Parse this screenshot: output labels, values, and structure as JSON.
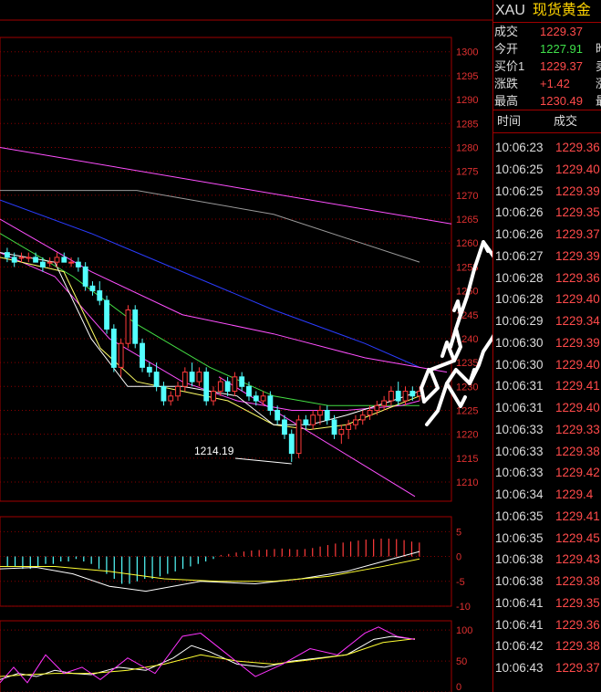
{
  "chart_data": [
    {
      "type": "candlestick",
      "ylim": [
        1206,
        1303
      ],
      "yticks": [
        1300,
        1295,
        1290,
        1285,
        1280,
        1275,
        1270,
        1265,
        1260,
        1255,
        1250,
        1245,
        1240,
        1235,
        1230,
        1225,
        1220,
        1215,
        1210
      ],
      "annotations": [
        "1214.19"
      ],
      "candles": [
        [
          1258,
          1259,
          1256,
          1257
        ],
        [
          1257,
          1258,
          1255,
          1256
        ],
        [
          1257,
          1258,
          1256,
          1257
        ],
        [
          1257,
          1258,
          1256,
          1257
        ],
        [
          1257,
          1258,
          1256,
          1256
        ],
        [
          1256,
          1257,
          1254,
          1255
        ],
        [
          1256,
          1257,
          1255,
          1256
        ],
        [
          1256,
          1258,
          1255,
          1257
        ],
        [
          1257,
          1258,
          1256,
          1256
        ],
        [
          1256,
          1257,
          1255,
          1256
        ],
        [
          1256,
          1257,
          1254,
          1255
        ],
        [
          1255,
          1256,
          1250,
          1251
        ],
        [
          1251,
          1252,
          1249,
          1250
        ],
        [
          1250,
          1252,
          1247,
          1248
        ],
        [
          1248,
          1249,
          1241,
          1242
        ],
        [
          1242,
          1243,
          1233,
          1234
        ],
        [
          1234,
          1240,
          1232,
          1239
        ],
        [
          1239,
          1247,
          1238,
          1246
        ],
        [
          1246,
          1247,
          1238,
          1239
        ],
        [
          1239,
          1240,
          1233,
          1234
        ],
        [
          1234,
          1235,
          1232,
          1233
        ],
        [
          1233,
          1235,
          1229,
          1230
        ],
        [
          1230,
          1231,
          1226,
          1227
        ],
        [
          1227,
          1229,
          1226,
          1228
        ],
        [
          1228,
          1231,
          1227,
          1230
        ],
        [
          1230,
          1234,
          1229,
          1233
        ],
        [
          1233,
          1235,
          1230,
          1231
        ],
        [
          1231,
          1234,
          1230,
          1233
        ],
        [
          1233,
          1234,
          1226,
          1227
        ],
        [
          1227,
          1230,
          1226,
          1229
        ],
        [
          1229,
          1232,
          1228,
          1231
        ],
        [
          1231,
          1232,
          1228,
          1229
        ],
        [
          1229,
          1233,
          1228,
          1232
        ],
        [
          1232,
          1233,
          1229,
          1230
        ],
        [
          1230,
          1231,
          1227,
          1228
        ],
        [
          1228,
          1229,
          1226,
          1227
        ],
        [
          1227,
          1229,
          1226,
          1228
        ],
        [
          1228,
          1229,
          1224,
          1225
        ],
        [
          1225,
          1226,
          1222,
          1223
        ],
        [
          1223,
          1224,
          1219,
          1220
        ],
        [
          1220,
          1221,
          1214.2,
          1216
        ],
        [
          1216,
          1224,
          1215,
          1223
        ],
        [
          1223,
          1224,
          1221,
          1222
        ],
        [
          1222,
          1225,
          1221,
          1224
        ],
        [
          1224,
          1226,
          1222,
          1225
        ],
        [
          1225,
          1226,
          1222,
          1223
        ],
        [
          1223,
          1224,
          1219,
          1220
        ],
        [
          1220,
          1222,
          1218,
          1221
        ],
        [
          1221,
          1223,
          1219,
          1222
        ],
        [
          1222,
          1224,
          1221,
          1223
        ],
        [
          1223,
          1225,
          1222,
          1224
        ],
        [
          1224,
          1226,
          1223,
          1225
        ],
        [
          1225,
          1227,
          1224,
          1226
        ],
        [
          1226,
          1228,
          1225,
          1227
        ],
        [
          1227,
          1230,
          1226,
          1229
        ],
        [
          1229,
          1231,
          1226,
          1227
        ],
        [
          1227,
          1230,
          1226,
          1229
        ],
        [
          1229,
          1230,
          1227,
          1228
        ],
        [
          1228,
          1230,
          1227,
          1229
        ]
      ],
      "ma_lines": [
        {
          "color": "#ff4fff",
          "points": [
            [
              0,
              1280
            ],
            [
              495,
              1264
            ]
          ]
        },
        {
          "color": "#9a9a9a",
          "points": [
            [
              0,
              1271
            ],
            [
              150,
              1271
            ],
            [
              300,
              1266
            ],
            [
              460,
              1256
            ]
          ]
        },
        {
          "color": "#2a3cff",
          "points": [
            [
              0,
              1269
            ],
            [
              100,
              1262
            ],
            [
              200,
              1254
            ],
            [
              300,
              1246
            ],
            [
              400,
              1239
            ],
            [
              460,
              1234
            ]
          ]
        },
        {
          "color": "#ff4fff",
          "points": [
            [
              0,
              1265
            ],
            [
              100,
              1254
            ],
            [
              200,
              1245
            ],
            [
              300,
              1241
            ],
            [
              400,
              1236
            ],
            [
              490,
              1233
            ]
          ]
        },
        {
          "color": "#44dd44",
          "points": [
            [
              0,
              1262
            ],
            [
              80,
              1253
            ],
            [
              150,
              1243
            ],
            [
              230,
              1234
            ],
            [
              300,
              1228
            ],
            [
              360,
              1226
            ],
            [
              410,
              1226
            ],
            [
              460,
              1226
            ]
          ]
        },
        {
          "color": "#ff4fff",
          "points": [
            [
              0,
              1258
            ],
            [
              60,
              1253
            ],
            [
              120,
              1240
            ],
            [
              200,
              1231
            ],
            [
              260,
              1227
            ],
            [
              320,
              1225
            ],
            [
              380,
              1225
            ],
            [
              440,
              1226
            ],
            [
              460,
              1227
            ]
          ]
        },
        {
          "color": "#ffff66",
          "points": [
            [
              0,
              1257
            ],
            [
              70,
              1254
            ],
            [
              110,
              1238
            ],
            [
              150,
              1231
            ],
            [
              200,
              1229
            ],
            [
              250,
              1227
            ],
            [
              300,
              1222
            ],
            [
              340,
              1221
            ],
            [
              380,
              1222
            ],
            [
              420,
              1225
            ],
            [
              460,
              1228
            ]
          ]
        },
        {
          "color": "#ffffff",
          "points": [
            [
              0,
              1258
            ],
            [
              60,
              1256
            ],
            [
              100,
              1240
            ],
            [
              140,
              1230
            ],
            [
              200,
              1230
            ],
            [
              260,
              1228
            ],
            [
              300,
              1222
            ],
            [
              340,
              1222
            ],
            [
              380,
              1224
            ],
            [
              430,
              1227
            ],
            [
              460,
              1229
            ]
          ]
        },
        {
          "color": "#ff4fff",
          "points": [
            [
              240,
              1232
            ],
            [
              455,
              1207
            ]
          ]
        }
      ]
    },
    {
      "type": "bar",
      "ylim": [
        -10,
        8
      ],
      "yticks": [
        5,
        0,
        -5,
        -10
      ],
      "macd_hist": [
        -2,
        -2,
        -2.5,
        -2.5,
        -2,
        -1.5,
        -1.5,
        -1,
        -1,
        -0.5,
        -1,
        -1.5,
        -2.5,
        -3.5,
        -4.5,
        -5.5,
        -5.5,
        -5,
        -4.5,
        -4.5,
        -4,
        -3.5,
        -3,
        -2.5,
        -2,
        -1.5,
        -1,
        -0.5,
        0.3,
        0.5,
        0.8,
        1,
        1.2,
        1.3,
        1.4,
        1.5,
        1.6,
        1.5,
        1.4,
        1.5,
        1.7,
        2,
        2.3,
        2.6,
        2.8,
        3,
        3.2,
        3.4,
        3.5,
        3.6,
        3.6,
        3.5,
        3.3,
        3,
        2.8
      ],
      "dif_points": [
        [
          0,
          -2.5
        ],
        [
          40,
          -2.2
        ],
        [
          80,
          -3.5
        ],
        [
          120,
          -6
        ],
        [
          160,
          -7
        ],
        [
          220,
          -5
        ],
        [
          280,
          -5.5
        ],
        [
          330,
          -4.5
        ],
        [
          380,
          -3
        ],
        [
          430,
          -0.5
        ],
        [
          460,
          1
        ]
      ],
      "dea_points": [
        [
          0,
          -2
        ],
        [
          60,
          -2
        ],
        [
          120,
          -3
        ],
        [
          180,
          -4.5
        ],
        [
          240,
          -5
        ],
        [
          300,
          -5
        ],
        [
          360,
          -4
        ],
        [
          420,
          -2
        ],
        [
          460,
          -0.5
        ]
      ]
    },
    {
      "type": "line",
      "ylim": [
        0,
        115
      ],
      "yticks": [
        100,
        50,
        0
      ],
      "series": [
        {
          "color": "#ffffff",
          "points": [
            [
              0,
              20
            ],
            [
              20,
              30
            ],
            [
              40,
              25
            ],
            [
              60,
              35
            ],
            [
              80,
              30
            ],
            [
              100,
              28
            ],
            [
              130,
              40
            ],
            [
              160,
              35
            ],
            [
              190,
              55
            ],
            [
              210,
              75
            ],
            [
              230,
              65
            ],
            [
              260,
              45
            ],
            [
              290,
              40
            ],
            [
              320,
              50
            ],
            [
              350,
              55
            ],
            [
              380,
              60
            ],
            [
              410,
              85
            ],
            [
              430,
              90
            ],
            [
              455,
              85
            ]
          ]
        },
        {
          "color": "#ffff33",
          "points": [
            [
              0,
              25
            ],
            [
              30,
              28
            ],
            [
              60,
              30
            ],
            [
              100,
              30
            ],
            [
              140,
              35
            ],
            [
              180,
              45
            ],
            [
              220,
              60
            ],
            [
              260,
              50
            ],
            [
              300,
              45
            ],
            [
              340,
              52
            ],
            [
              380,
              60
            ],
            [
              420,
              80
            ],
            [
              455,
              86
            ]
          ]
        },
        {
          "color": "#ff33ff",
          "points": [
            [
              0,
              15
            ],
            [
              15,
              40
            ],
            [
              30,
              15
            ],
            [
              50,
              60
            ],
            [
              70,
              30
            ],
            [
              90,
              40
            ],
            [
              110,
              20
            ],
            [
              140,
              55
            ],
            [
              170,
              30
            ],
            [
              200,
              90
            ],
            [
              220,
              95
            ],
            [
              250,
              60
            ],
            [
              280,
              25
            ],
            [
              310,
              45
            ],
            [
              340,
              70
            ],
            [
              370,
              60
            ],
            [
              400,
              95
            ],
            [
              415,
              105
            ],
            [
              435,
              90
            ],
            [
              455,
              85
            ]
          ]
        }
      ]
    }
  ],
  "quote": {
    "code": "XAU",
    "name": "现货黄金",
    "rows": [
      {
        "k": "成交",
        "v": "1229.37",
        "c": "red",
        "e": ""
      },
      {
        "k": "今开",
        "v": "1227.91",
        "c": "green",
        "e": "昨"
      },
      {
        "k": "买价1",
        "v": "1229.37",
        "c": "red",
        "e": "卖"
      },
      {
        "k": "涨跌",
        "v": "+1.42",
        "c": "red",
        "e": "涨"
      },
      {
        "k": "最高",
        "v": "1230.49",
        "c": "red",
        "e": "最"
      }
    ],
    "th_time": "时间",
    "th_deal": "成交",
    "ticks": [
      {
        "t": "10:06:23",
        "p": "1229.36"
      },
      {
        "t": "10:06:25",
        "p": "1229.40"
      },
      {
        "t": "10:06:25",
        "p": "1229.39"
      },
      {
        "t": "10:06:26",
        "p": "1229.35"
      },
      {
        "t": "10:06:26",
        "p": "1229.37"
      },
      {
        "t": "10:06:27",
        "p": "1229.39"
      },
      {
        "t": "10:06:28",
        "p": "1229.36"
      },
      {
        "t": "10:06:28",
        "p": "1229.40"
      },
      {
        "t": "10:06:29",
        "p": "1229.34"
      },
      {
        "t": "10:06:30",
        "p": "1229.39"
      },
      {
        "t": "10:06:30",
        "p": "1229.40"
      },
      {
        "t": "10:06:31",
        "p": "1229.41"
      },
      {
        "t": "10:06:31",
        "p": "1229.40"
      },
      {
        "t": "10:06:33",
        "p": "1229.33"
      },
      {
        "t": "10:06:33",
        "p": "1229.38"
      },
      {
        "t": "10:06:33",
        "p": "1229.42"
      },
      {
        "t": "10:06:34",
        "p": "1229.4"
      },
      {
        "t": "10:06:35",
        "p": "1229.41"
      },
      {
        "t": "10:06:35",
        "p": "1229.45"
      },
      {
        "t": "10:06:38",
        "p": "1229.43"
      },
      {
        "t": "10:06:38",
        "p": "1229.38"
      },
      {
        "t": "10:06:41",
        "p": "1229.35"
      },
      {
        "t": "10:06:41",
        "p": "1229.36"
      },
      {
        "t": "10:06:42",
        "p": "1229.38"
      },
      {
        "t": "10:06:43",
        "p": "1229.37"
      }
    ]
  }
}
